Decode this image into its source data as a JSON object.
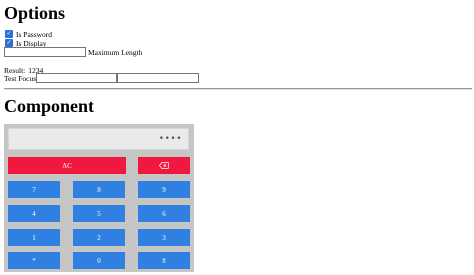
{
  "options": {
    "heading": "Options",
    "is_password": {
      "label": "Is Password",
      "checked": true
    },
    "is_display": {
      "label": "Is Display",
      "checked": true
    },
    "max_length": {
      "value": "",
      "label": "Maximum Length"
    },
    "result": {
      "label": "Result:",
      "value": "1234"
    },
    "test_focus": {
      "label": "Test Focus",
      "input1_value": "",
      "input2_value": ""
    }
  },
  "component": {
    "heading": "Component",
    "display_value": "••••",
    "keys": {
      "ac": "AC",
      "backspace_icon": "backspace-icon",
      "row1": [
        "7",
        "8",
        "9"
      ],
      "row2": [
        "4",
        "5",
        "6"
      ],
      "row3": [
        "1",
        "2",
        "3"
      ],
      "row4": [
        "*",
        "0",
        "#"
      ]
    },
    "colors": {
      "digit_key": "#2f80e0",
      "function_key": "#f0183e",
      "pad_background": "#c6c6c6"
    }
  }
}
